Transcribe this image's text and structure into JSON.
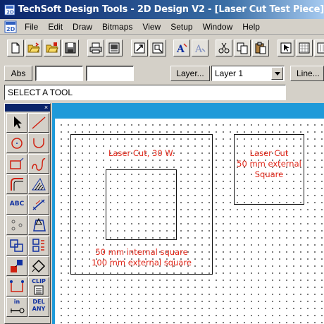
{
  "window": {
    "title": "TechSoft Design Tools - 2D Design V2 - [Laser Cut Test Piece]"
  },
  "menu": [
    "File",
    "Edit",
    "Draw",
    "Bitmaps",
    "View",
    "Setup",
    "Window",
    "Help"
  ],
  "toolbar": {
    "buttons": [
      "new-icon",
      "open-icon",
      "open-library-icon",
      "save-icon",
      "print-icon",
      "print-preview-icon",
      "zoom-fit-icon",
      "zoom-window-icon",
      "text-bold-icon",
      "text-outline-icon",
      "cut-icon",
      "copy-icon",
      "paste-icon",
      "select-icon",
      "grid-icon"
    ]
  },
  "inputs": {
    "abs_label": "Abs",
    "x_value": "",
    "y_value": "",
    "layer_button": "Layer...",
    "layer_value": "Layer 1",
    "line_button": "Line..."
  },
  "prompt": "SELECT A TOOL",
  "palette": {
    "close": "×",
    "text_tool": "ABC",
    "clip_label": "CLIP",
    "in_label": "in",
    "del_label_1": "DEL",
    "del_label_2": "ANY"
  },
  "drawing": {
    "left_label_top": "Laser Cut, 30 W.",
    "left_label_bottom_1": "50 mm internal square",
    "left_label_bottom_2": "100 mm external square",
    "right_label_1": "Laser Cut",
    "right_label_2": "50 mm external",
    "right_label_3": "Square"
  },
  "colors": {
    "title_bar": "#0a246a",
    "drawing_frame": "#1f9ad9",
    "annotation": "#e02618"
  }
}
